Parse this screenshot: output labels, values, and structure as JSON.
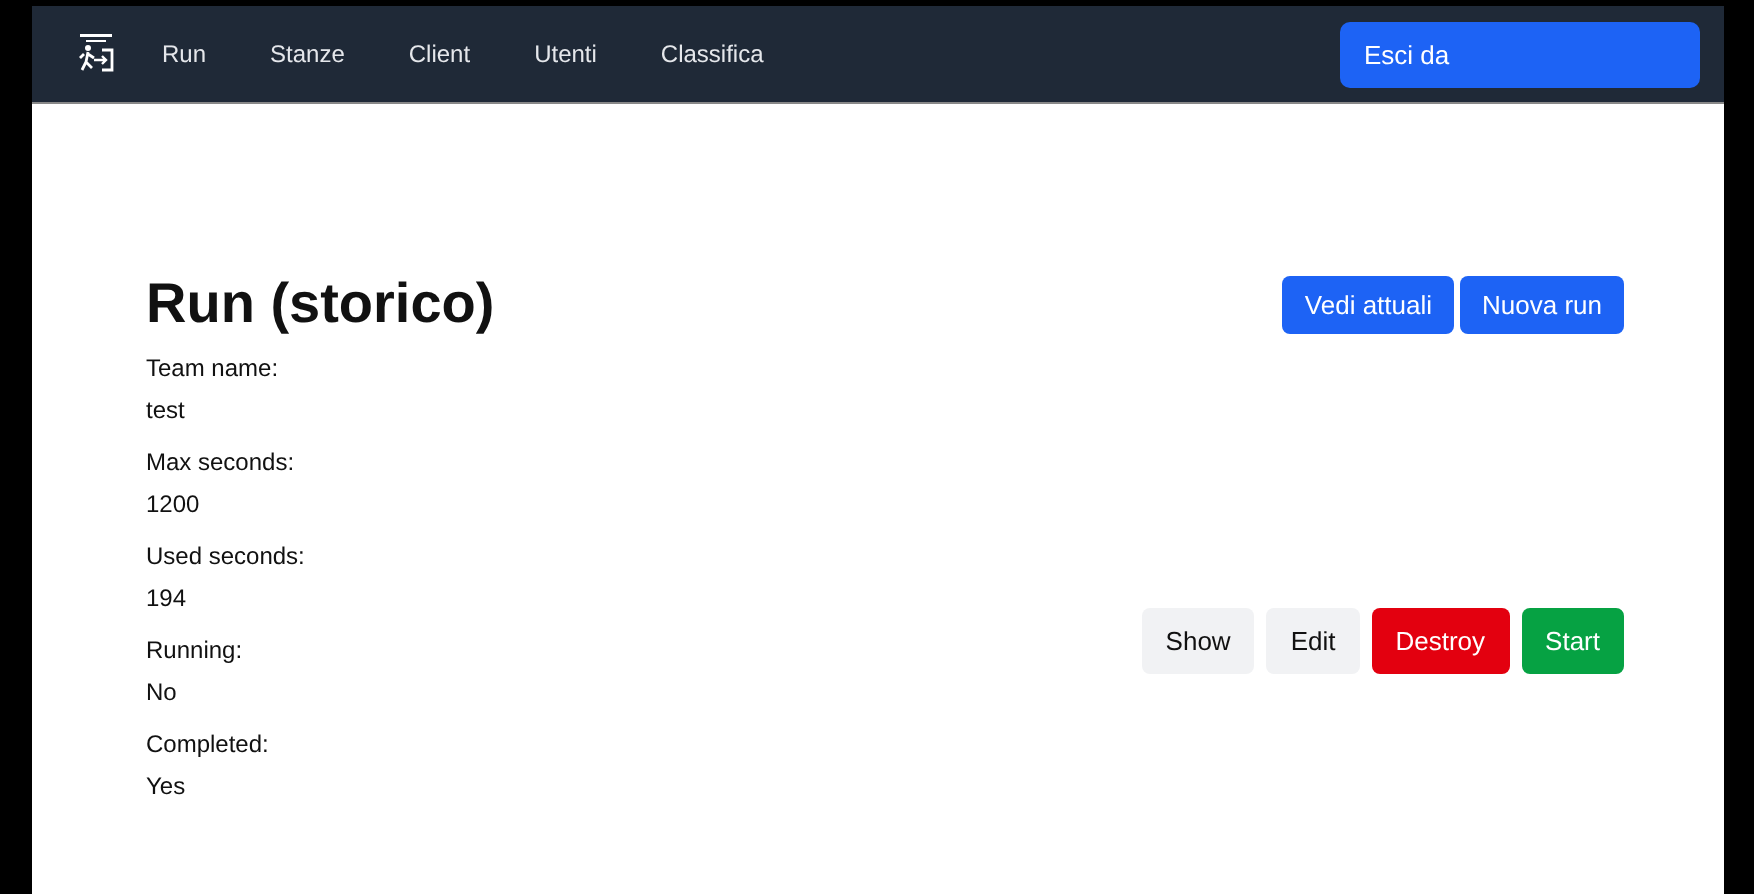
{
  "nav": {
    "links": [
      {
        "label": "Run"
      },
      {
        "label": "Stanze"
      },
      {
        "label": "Client"
      },
      {
        "label": "Utenti"
      },
      {
        "label": "Classifica"
      }
    ],
    "logout": "Esci da"
  },
  "title": "Run (storico)",
  "header_buttons": [
    {
      "label": "Vedi attuali",
      "kind": "primary"
    },
    {
      "label": "Nuova run",
      "kind": "primary"
    }
  ],
  "fields": [
    {
      "label": "Team name:",
      "value": "test"
    },
    {
      "label": "Max seconds:",
      "value": "1200"
    },
    {
      "label": "Used seconds:",
      "value": "194"
    },
    {
      "label": "Running:",
      "value": "No"
    },
    {
      "label": "Completed:",
      "value": "Yes"
    }
  ],
  "actions": [
    {
      "label": "Show",
      "kind": "light"
    },
    {
      "label": "Edit",
      "kind": "light"
    },
    {
      "label": "Destroy",
      "kind": "danger"
    },
    {
      "label": "Start",
      "kind": "success"
    }
  ]
}
